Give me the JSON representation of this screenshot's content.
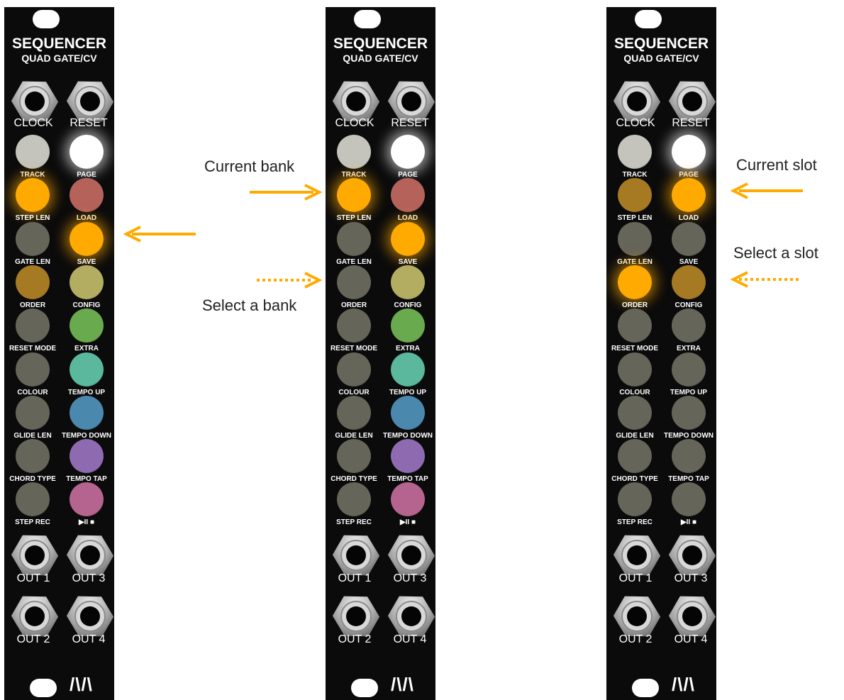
{
  "module": {
    "title": "SEQUENCER",
    "subtitle": "QUAD GATE/CV",
    "jacks_top": [
      "CLOCK",
      "RESET"
    ],
    "jacks_bottom_row1": [
      "OUT 1",
      "OUT 3"
    ],
    "jacks_bottom_row2": [
      "OUT 2",
      "OUT 4"
    ],
    "button_labels": [
      [
        "TRACK",
        "PAGE"
      ],
      [
        "STEP LEN",
        "LOAD"
      ],
      [
        "GATE LEN",
        "SAVE"
      ],
      [
        "ORDER",
        "CONFIG"
      ],
      [
        "RESET MODE",
        "EXTRA"
      ],
      [
        "COLOUR",
        "TEMPO UP"
      ],
      [
        "GLIDE LEN",
        "TEMPO DOWN"
      ],
      [
        "CHORD TYPE",
        "TEMPO TAP"
      ],
      [
        "STEP REC",
        "▶II ■"
      ]
    ],
    "logo": "/\\/\\"
  },
  "panels": [
    {
      "buttons": [
        [
          "#c4c4bd",
          "#ffffff"
        ],
        [
          "#ffaa00",
          "#b4625a"
        ],
        [
          "#66655a",
          "#ffaa00"
        ],
        [
          "#a67a22",
          "#b3ad62"
        ],
        [
          "#66655a",
          "#6aaa4e"
        ],
        [
          "#66655a",
          "#5bb89c"
        ],
        [
          "#66655a",
          "#4a88ad"
        ],
        [
          "#66655a",
          "#8e6bb0"
        ],
        [
          "#66655a",
          "#b5648f"
        ]
      ],
      "glow": [
        [
          false,
          true
        ],
        [
          true,
          false
        ],
        [
          false,
          true
        ],
        [
          false,
          false
        ],
        [
          false,
          false
        ],
        [
          false,
          false
        ],
        [
          false,
          false
        ],
        [
          false,
          false
        ],
        [
          false,
          false
        ]
      ]
    },
    {
      "buttons": [
        [
          "#c4c4bd",
          "#ffffff"
        ],
        [
          "#ffaa00",
          "#b4625a"
        ],
        [
          "#66655a",
          "#ffaa00"
        ],
        [
          "#66655a",
          "#b3ad62"
        ],
        [
          "#66655a",
          "#6aaa4e"
        ],
        [
          "#66655a",
          "#5bb89c"
        ],
        [
          "#66655a",
          "#4a88ad"
        ],
        [
          "#66655a",
          "#8e6bb0"
        ],
        [
          "#66655a",
          "#b5648f"
        ]
      ],
      "glow": [
        [
          false,
          true
        ],
        [
          true,
          false
        ],
        [
          false,
          true
        ],
        [
          false,
          false
        ],
        [
          false,
          false
        ],
        [
          false,
          false
        ],
        [
          false,
          false
        ],
        [
          false,
          false
        ],
        [
          false,
          false
        ]
      ]
    },
    {
      "buttons": [
        [
          "#c4c4bd",
          "#ffffff"
        ],
        [
          "#a67a22",
          "#ffaa00"
        ],
        [
          "#66655a",
          "#66655a"
        ],
        [
          "#ffaa00",
          "#a67a22"
        ],
        [
          "#66655a",
          "#66655a"
        ],
        [
          "#66655a",
          "#66655a"
        ],
        [
          "#66655a",
          "#66655a"
        ],
        [
          "#66655a",
          "#66655a"
        ],
        [
          "#66655a",
          "#66655a"
        ]
      ],
      "glow": [
        [
          false,
          true
        ],
        [
          false,
          true
        ],
        [
          false,
          false
        ],
        [
          true,
          false
        ],
        [
          false,
          false
        ],
        [
          false,
          false
        ],
        [
          false,
          false
        ],
        [
          false,
          false
        ],
        [
          false,
          false
        ]
      ]
    }
  ],
  "annotations": {
    "current_bank": "Current bank",
    "select_bank": "Select a bank",
    "current_slot": "Current slot",
    "select_slot": "Select a slot",
    "arrow_color": "#ffaa00"
  }
}
